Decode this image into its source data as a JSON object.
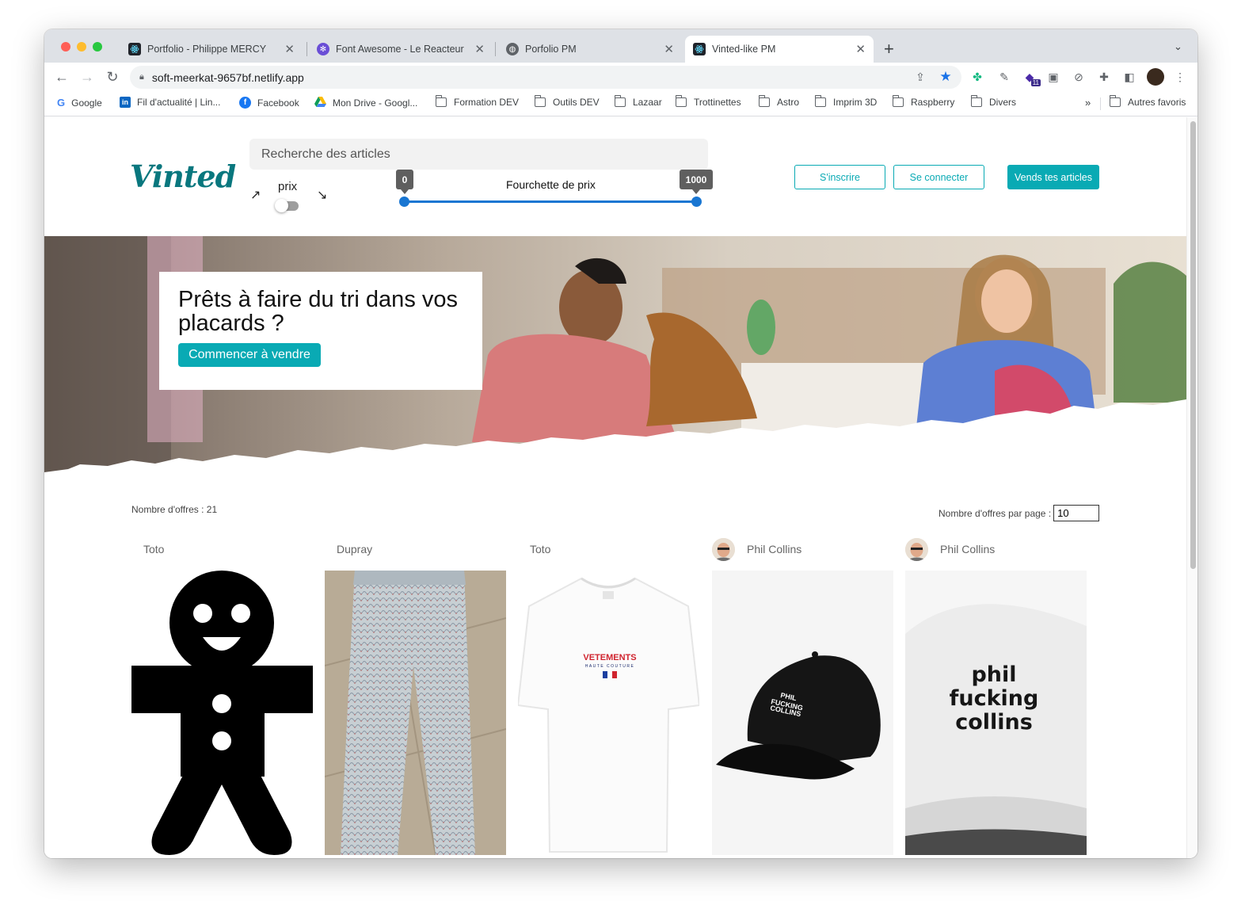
{
  "browser": {
    "tabs": [
      {
        "title": "Portfolio - Philippe MERCY",
        "icon": "react-icon"
      },
      {
        "title": "Font Awesome - Le Reacteur",
        "icon": "font-awesome-icon"
      },
      {
        "title": "Porfolio PM",
        "icon": "globe-icon"
      },
      {
        "title": "Vinted-like PM",
        "icon": "react-icon"
      }
    ],
    "active_tab": 3,
    "url": "soft-meerkat-9657bf.netlify.app",
    "bookmarks": [
      {
        "label": "Google",
        "icon": "google-icon"
      },
      {
        "label": "Fil d'actualité | Lin...",
        "icon": "linkedin-icon"
      },
      {
        "label": "Facebook",
        "icon": "facebook-icon"
      },
      {
        "label": "Mon Drive - Googl...",
        "icon": "drive-icon"
      },
      {
        "label": "Formation DEV",
        "icon": "folder-icon"
      },
      {
        "label": "Outils DEV",
        "icon": "folder-icon"
      },
      {
        "label": "Lazaar",
        "icon": "folder-icon"
      },
      {
        "label": "Trottinettes",
        "icon": "folder-icon"
      },
      {
        "label": "Astro",
        "icon": "folder-icon"
      },
      {
        "label": "Imprim 3D",
        "icon": "folder-icon"
      },
      {
        "label": "Raspberry",
        "icon": "folder-icon"
      },
      {
        "label": "Divers",
        "icon": "folder-icon"
      }
    ],
    "bookmarks_overflow": "»",
    "other_bookmarks": "Autres favoris",
    "extension_badge": "11"
  },
  "header": {
    "logo": "Vinted",
    "search_placeholder": "Recherche des articles",
    "sort_label": "prix",
    "price_range": {
      "title": "Fourchette de prix",
      "min": 0,
      "max": 1000,
      "min_label": "0",
      "max_label": "1000"
    },
    "signup_label": "S'inscrire",
    "login_label": "Se connecter",
    "sell_label": "Vends tes articles"
  },
  "hero": {
    "title": "Prêts à faire du tri dans vos placards ?",
    "cta_label": "Commencer à vendre"
  },
  "offers": {
    "count_text": "Nombre d'offres : 21",
    "per_page_label": "Nombre d'offres par page :",
    "per_page_value": "10",
    "items": [
      {
        "owner": "Toto",
        "has_avatar": false,
        "image": "gingerbread-man-icon"
      },
      {
        "owner": "Dupray",
        "has_avatar": false,
        "image": "jeans-photo"
      },
      {
        "owner": "Toto",
        "has_avatar": false,
        "image": "tshirt-photo",
        "print_title": "VETEMENTS",
        "print_sub": "HAUTE COUTURE"
      },
      {
        "owner": "Phil Collins",
        "has_avatar": true,
        "image": "black-cap-photo",
        "print_lines": [
          "PHIL",
          "FUCKING",
          "COLLINS"
        ]
      },
      {
        "owner": "Phil Collins",
        "has_avatar": true,
        "image": "white-cap-photo",
        "print_lines": [
          "phil",
          "fucking",
          "collins"
        ]
      }
    ]
  },
  "colors": {
    "brand": "#09aab4",
    "logo": "#09777e",
    "slider": "#1976d2"
  }
}
